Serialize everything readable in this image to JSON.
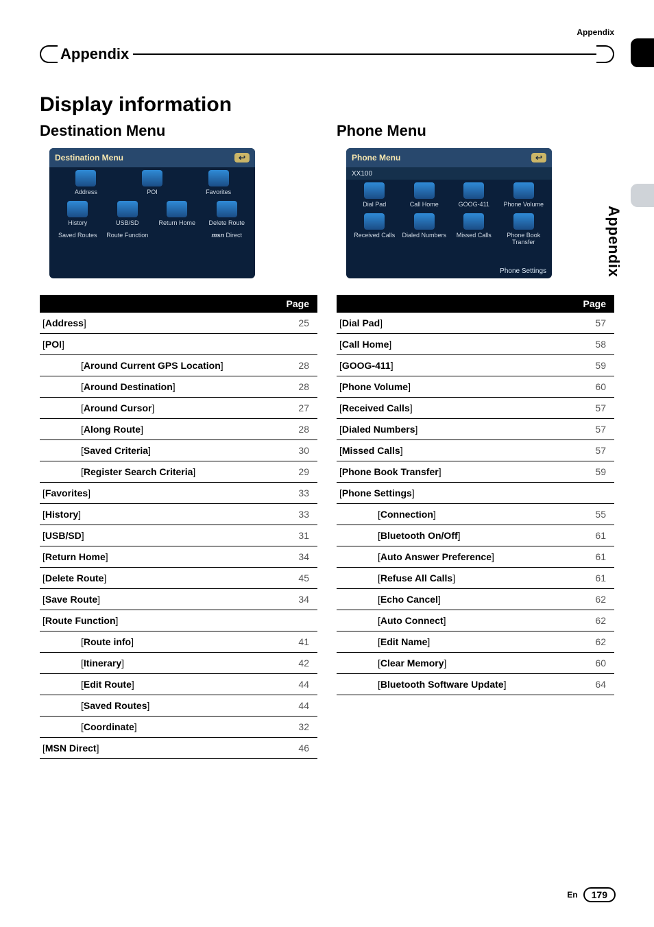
{
  "appendix_label": "Appendix",
  "chapter_title": "Appendix",
  "side_label": "Appendix",
  "main_heading": "Display information",
  "left": {
    "section_title": "Destination Menu",
    "screenshot": {
      "header": "Destination Menu",
      "back": "↩",
      "tiles_row1": [
        "Address",
        "POI",
        "Favorites"
      ],
      "tiles_row2": [
        "History",
        "USB/SD",
        "Return Home",
        "Delete Route"
      ],
      "tiles_row3": [
        "Saved Routes",
        "Route Function"
      ],
      "msn": "msn",
      "direct": "Direct"
    },
    "page_header": "Page",
    "rows": [
      {
        "label": "Address",
        "page": "25",
        "indent": false
      },
      {
        "label": "POI",
        "page": "",
        "indent": false
      },
      {
        "label": "Around Current GPS Location",
        "page": "28",
        "indent": true
      },
      {
        "label": "Around Destination",
        "page": "28",
        "indent": true
      },
      {
        "label": "Around Cursor",
        "page": "27",
        "indent": true
      },
      {
        "label": "Along Route",
        "page": "28",
        "indent": true
      },
      {
        "label": "Saved Criteria",
        "page": "30",
        "indent": true
      },
      {
        "label": "Register Search Criteria",
        "page": "29",
        "indent": true
      },
      {
        "label": "Favorites",
        "page": "33",
        "indent": false
      },
      {
        "label": "History",
        "page": "33",
        "indent": false
      },
      {
        "label": "USB/SD",
        "page": "31",
        "indent": false
      },
      {
        "label": "Return Home",
        "page": "34",
        "indent": false
      },
      {
        "label": "Delete Route",
        "page": "45",
        "indent": false
      },
      {
        "label": "Save Route",
        "page": "34",
        "indent": false
      },
      {
        "label": "Route Function",
        "page": "",
        "indent": false
      },
      {
        "label": "Route info",
        "page": "41",
        "indent": true
      },
      {
        "label": "Itinerary",
        "page": "42",
        "indent": true
      },
      {
        "label": "Edit Route",
        "page": "44",
        "indent": true
      },
      {
        "label": "Saved Routes",
        "page": "44",
        "indent": true
      },
      {
        "label": "Coordinate",
        "page": "32",
        "indent": true
      },
      {
        "label": "MSN Direct",
        "page": "46",
        "indent": false
      }
    ]
  },
  "right": {
    "section_title": "Phone Menu",
    "screenshot": {
      "header": "Phone Menu",
      "back": "↩",
      "sub_left": "XX100",
      "tiles_row1": [
        "Dial Pad",
        "Call Home",
        "GOOG-411",
        "Phone Volume"
      ],
      "tiles_row2": [
        "Received Calls",
        "Dialed Numbers",
        "Missed Calls",
        "Phone Book Transfer"
      ],
      "footer_right": "Phone Settings"
    },
    "page_header": "Page",
    "rows": [
      {
        "label": "Dial Pad",
        "page": "57",
        "indent": false
      },
      {
        "label": "Call Home",
        "page": "58",
        "indent": false
      },
      {
        "label": "GOOG-411",
        "page": "59",
        "indent": false
      },
      {
        "label": "Phone Volume",
        "page": "60",
        "indent": false
      },
      {
        "label": "Received Calls",
        "page": "57",
        "indent": false
      },
      {
        "label": "Dialed Numbers",
        "page": "57",
        "indent": false
      },
      {
        "label": "Missed Calls",
        "page": "57",
        "indent": false
      },
      {
        "label": "Phone Book Transfer",
        "page": "59",
        "indent": false
      },
      {
        "label": "Phone Settings",
        "page": "",
        "indent": false
      },
      {
        "label": "Connection",
        "page": "55",
        "indent": true
      },
      {
        "label": "Bluetooth On/Off",
        "page": "61",
        "indent": true
      },
      {
        "label": "Auto Answer Preference",
        "page": "61",
        "indent": true
      },
      {
        "label": "Refuse All Calls",
        "page": "61",
        "indent": true
      },
      {
        "label": "Echo Cancel",
        "page": "62",
        "indent": true
      },
      {
        "label": "Auto Connect",
        "page": "62",
        "indent": true
      },
      {
        "label": "Edit Name",
        "page": "62",
        "indent": true
      },
      {
        "label": "Clear Memory",
        "page": "60",
        "indent": true
      },
      {
        "label": "Bluetooth Software Update",
        "page": "64",
        "indent": true
      }
    ]
  },
  "footer": {
    "lang": "En",
    "page": "179"
  }
}
